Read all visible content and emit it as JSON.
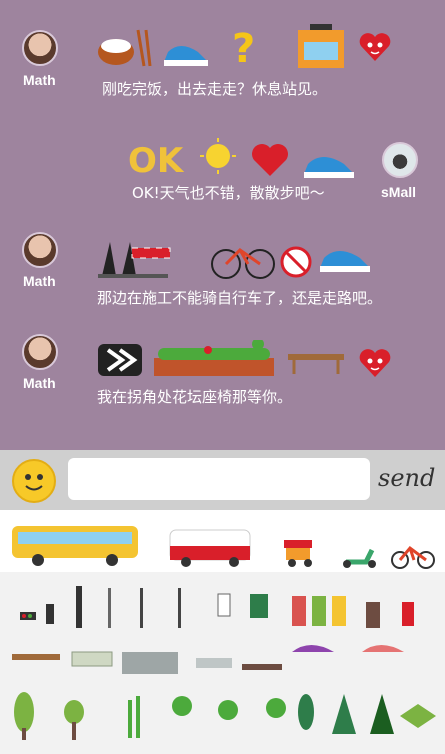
{
  "messages": [
    {
      "user": "Math",
      "text": "刚吃完饭，出去走走？休息站见。"
    },
    {
      "user": "sMall",
      "text": "OK!天气也不错，散散步吧～"
    },
    {
      "user": "Math",
      "text": "那边在施工不能骑自行车了，还是走路吧。"
    },
    {
      "user": "Math",
      "text": "我在拐角处花坛座椅那等你。"
    }
  ],
  "composer": {
    "send_label": "send",
    "placeholder": ""
  },
  "ok_text": "OK",
  "colors": {
    "background": "#9e849e",
    "heart": "#d91f2a",
    "accent": "#f7c928"
  },
  "sticker_panel": {
    "row1": [
      "bus-icon",
      "camper-van-icon",
      "food-cart-icon",
      "scooter-icon",
      "bicycle-icon"
    ],
    "row2": [
      "traffic-light-icon",
      "street-lamp-icon",
      "sign-post-icon",
      "mailbox-icon",
      "trash-bins-icon",
      "fire-hydrant-icon"
    ],
    "row3": [
      "bench-icon",
      "picnic-table-icon",
      "parasol-table-icon"
    ],
    "row4": [
      "tree-icon",
      "pine-tree-icon",
      "lawn-icon"
    ]
  }
}
